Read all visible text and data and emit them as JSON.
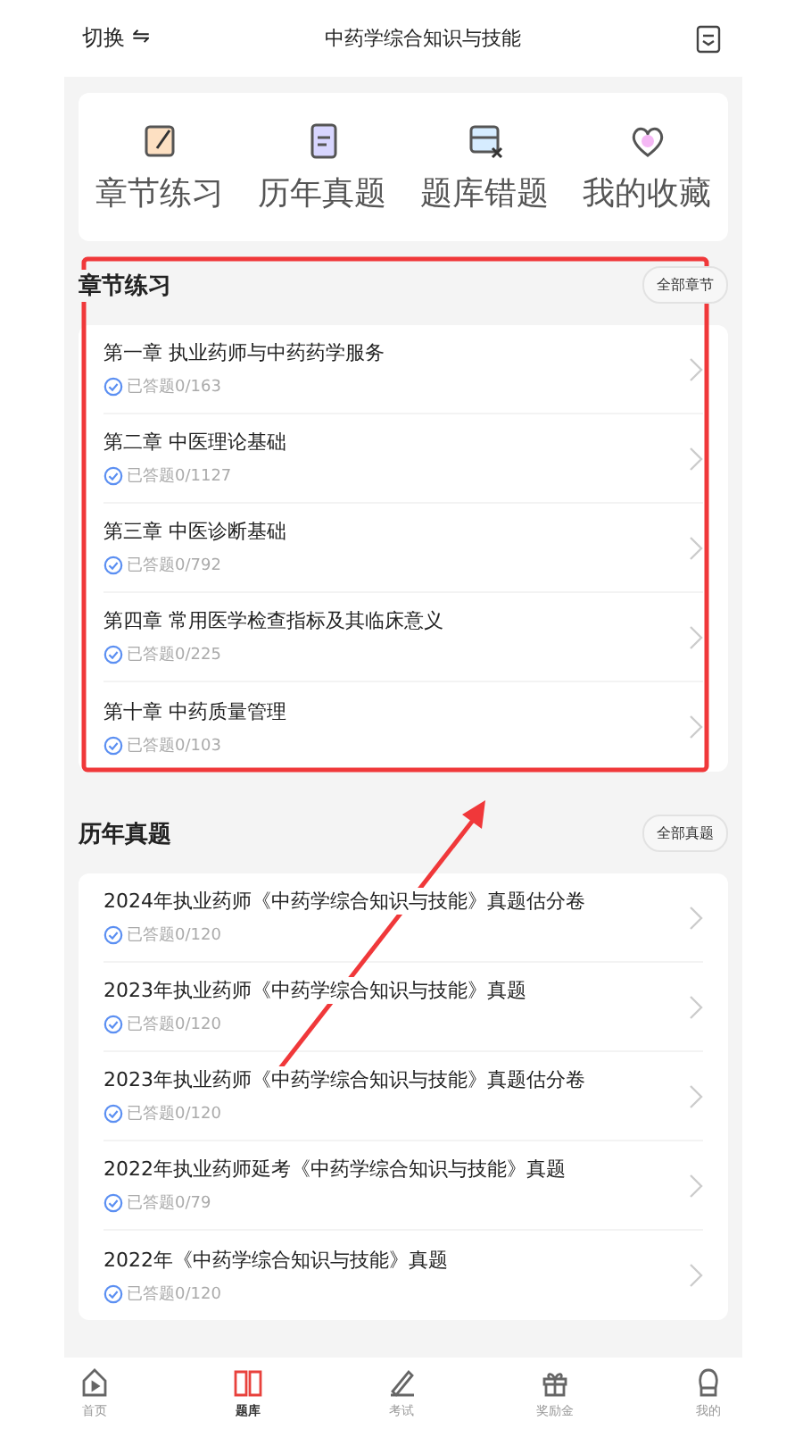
{
  "header": {
    "switch_label": "切换",
    "switch_icon": "⇋",
    "title": "中药学综合知识与技能"
  },
  "shortcuts": [
    {
      "kind": "edit",
      "label": "章节练习"
    },
    {
      "kind": "doc",
      "label": "历年真题"
    },
    {
      "kind": "wrong",
      "label": "题库错题"
    },
    {
      "kind": "heart",
      "label": "我的收藏"
    }
  ],
  "sections": [
    {
      "title": "章节练习",
      "more": "全部章节",
      "items": [
        {
          "title": "第一章 执业药师与中药药学服务",
          "progress": "已答题0/163"
        },
        {
          "title": "第二章 中医理论基础",
          "progress": "已答题0/1127"
        },
        {
          "title": "第三章 中医诊断基础",
          "progress": "已答题0/792"
        },
        {
          "title": "第四章 常用医学检查指标及其临床意义",
          "progress": "已答题0/225"
        },
        {
          "title": "第十章 中药质量管理",
          "progress": "已答题0/103"
        }
      ]
    },
    {
      "title": "历年真题",
      "more": "全部真题",
      "items": [
        {
          "title": "2024年执业药师《中药学综合知识与技能》真题估分卷",
          "progress": "已答题0/120"
        },
        {
          "title": "2023年执业药师《中药学综合知识与技能》真题",
          "progress": "已答题0/120"
        },
        {
          "title": "2023年执业药师《中药学综合知识与技能》真题估分卷",
          "progress": "已答题0/120"
        },
        {
          "title": "2022年执业药师延考《中药学综合知识与技能》真题",
          "progress": "已答题0/79"
        },
        {
          "title": "2022年《中药学综合知识与技能》真题",
          "progress": "已答题0/120"
        }
      ]
    }
  ],
  "tabs": [
    {
      "kind": "home",
      "label": "首页",
      "selected": false
    },
    {
      "kind": "book",
      "label": "题库",
      "selected": true
    },
    {
      "kind": "pen",
      "label": "考试",
      "selected": false
    },
    {
      "kind": "gift",
      "label": "奖励金",
      "selected": false
    },
    {
      "kind": "user",
      "label": "我的",
      "selected": false
    }
  ]
}
